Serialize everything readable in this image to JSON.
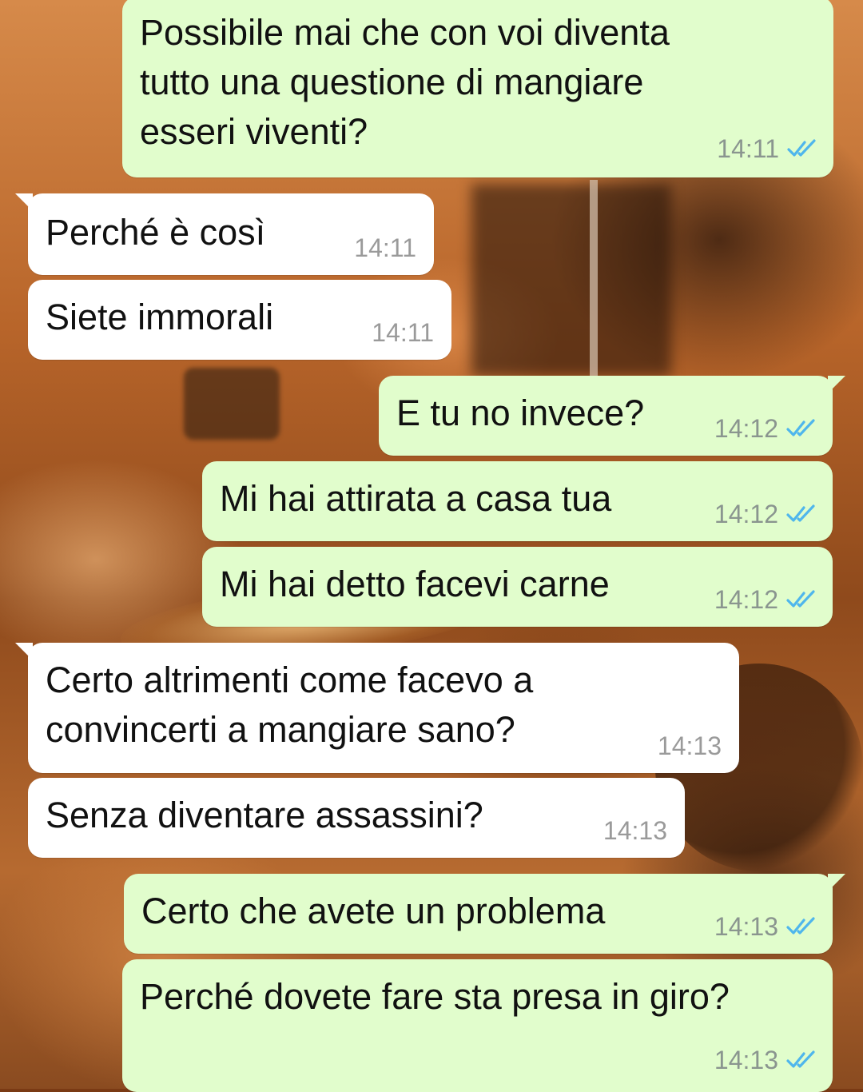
{
  "chat": {
    "messages": [
      {
        "id": "m1",
        "direction": "outgoing",
        "text": "Possibile mai che con voi diventa\ntutto una questione di mangiare\nesseri viventi?",
        "time": "14:11",
        "status": "read"
      },
      {
        "id": "m2",
        "direction": "incoming",
        "text": "Perché è così",
        "time": "14:11"
      },
      {
        "id": "m3",
        "direction": "incoming",
        "text": "Siete immorali",
        "time": "14:11"
      },
      {
        "id": "m4",
        "direction": "outgoing",
        "text": "E tu no invece?",
        "time": "14:12",
        "status": "read"
      },
      {
        "id": "m5",
        "direction": "outgoing",
        "text": "Mi hai attirata a casa tua",
        "time": "14:12",
        "status": "read"
      },
      {
        "id": "m6",
        "direction": "outgoing",
        "text": "Mi hai detto facevi carne",
        "time": "14:12",
        "status": "read"
      },
      {
        "id": "m7",
        "direction": "incoming",
        "text": "Certo altrimenti come facevo a\nconvincerti a mangiare sano?",
        "time": "14:13"
      },
      {
        "id": "m8",
        "direction": "incoming",
        "text": "Senza diventare assassini?",
        "time": "14:13"
      },
      {
        "id": "m9",
        "direction": "outgoing",
        "text": "Certo che avete un problema",
        "time": "14:13",
        "status": "read"
      },
      {
        "id": "m10",
        "direction": "outgoing",
        "text": "Perché dovete fare sta presa in giro?",
        "time": "14:13",
        "status": "read"
      }
    ]
  },
  "colors": {
    "outgoing_bubble": "#e1fdcc",
    "incoming_bubble": "#ffffff",
    "read_ticks": "#4fb6ec",
    "timestamp": "#8a958f"
  },
  "icons": {
    "read_receipt": "double-check-icon"
  }
}
